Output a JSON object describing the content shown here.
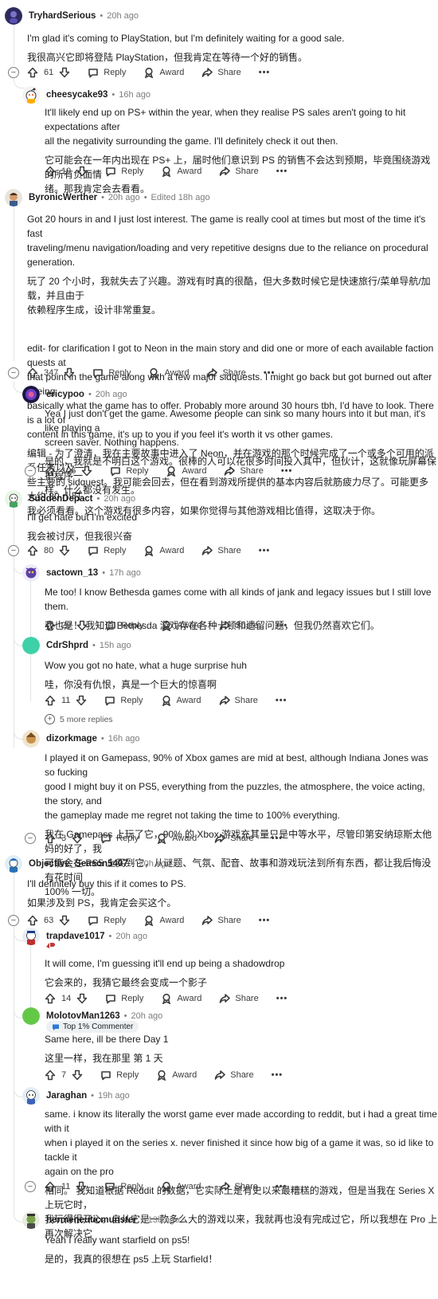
{
  "labels": {
    "reply": "Reply",
    "award": "Award",
    "share": "Share",
    "more": "•••"
  },
  "comments": [
    {
      "author": "TryhardSerious",
      "time": "20h ago",
      "votes": "61",
      "lines": [
        "I'm glad it's coming to PlayStation, but I'm definitely waiting for a good sale.",
        "我很高兴它即将登陆 PlayStation，但我肯定在等待一个好的销售。"
      ]
    },
    {
      "author": "cheesycake93",
      "time": "16h ago",
      "votes": "19",
      "lines": [
        "It'll likely end up on PS+ within the year, when they realise PS sales aren't going to hit expectations after",
        "all the negativity surrounding the game. I'll definitely check it out then.",
        "它可能会在一年内出现在 PS+ 上，届时他们意识到 PS 的销售不会达到预期，毕竟围绕游戏的所有负面情",
        "绪。那我肯定会去看看。"
      ]
    },
    {
      "author": "ByronicWerther",
      "time": "20h ago",
      "edited": "Edited 18h ago",
      "votes": "347",
      "lines": [
        "Got 20 hours in and I just lost interest. The game is really cool at times but most of the time it's fast",
        "traveling/menu navigation/loading and very repetitive designs due to the reliance on procedural generation.",
        "玩了 20 个小时，我就失去了兴趣。游戏有时真的很酷，但大多数时候它是快速旅行/菜单导航/加载，并且由于",
        "依赖程序生成，设计非常重复。",
        "edit- for clarification I got to Neon in the main story and did one or more of each available faction quests at",
        "that point in the game along with a few major sidquests. I might go back but got burned out after seeing",
        "basically what the game has to offer. Probably more around 30 hours tbh, I'd have to look. There is a lot of",
        "content in this game, it's up to you if you feel it's worth it vs other games.",
        "编辑 - 为了澄清，我在主要故事中进入了 Neon，并在游戏的那个时候完成了一个或多个可用的派系任务以及一",
        "些主要的 sidquest。我可能会回去，但在看到游戏所提供的基本内容后就筋疲力尽了。可能更多大约 30 小时，",
        "我必须看看。这个游戏有很多内容，如果你觉得与其他游戏相比值得，这取决于你。"
      ]
    },
    {
      "author": "ericypoo",
      "time": "20h ago",
      "votes": "106",
      "lines": [
        "Yea I just don't get the game. Awesome people can sink so many hours into it but man, it's like playing a",
        "screen saver. Nothing happens.",
        "是的，我就是不明白这个游戏。很棒的人可以花很多时间投入其中，但伙计，这就像玩屏幕保护程序一",
        "样。什么都没有发生。"
      ]
    },
    {
      "author": "SuddenDepact",
      "time": "20h ago",
      "votes": "80",
      "lines": [
        "I'll get hate but I'm excited",
        "我会被讨厌，但我很兴奋"
      ]
    },
    {
      "author": "sactown_13",
      "time": "17h ago",
      "votes": "20",
      "lines": [
        "Me too! I know Bethesda games come with all kinds of jank and legacy issues but I still love them.",
        "我也是！ 我知道 Bethesda 游戏存在各种卡顿和遗留问题，但我仍然喜欢它们。"
      ]
    },
    {
      "author": "CdrShprd",
      "time": "15h ago",
      "votes": "11",
      "lines": [
        "Wow you got no hate, what a huge surprise huh",
        "哇，你没有仇恨，真是一个巨大的惊喜啊"
      ],
      "more_replies": "5 more replies"
    },
    {
      "author": "dizorkmage",
      "time": "16h ago",
      "votes": "3",
      "lines": [
        "I played it on Gamepass, 90% of Xbox games are mid at best, although Indiana Jones was so fucking",
        "good I might buy it on PS5, everything from the puzzles, the atmosphere, the voice acting, the story, and",
        "the gameplay made me regret not taking the time to 100% everything.",
        "我在 Gamepass 上玩了它，90% 的 Xbox 游戏充其量只是中等水平，尽管印第安纳琼斯太他妈的好了，我",
        "可能会在 PS5 上买到它，从谜题、气氛、配音、故事和游戏玩法到所有东西，都让我后悔没有花时间",
        "100% 一切。"
      ]
    },
    {
      "author": "Objective_Season5407",
      "time": "20h ago",
      "votes": "63",
      "lines": [
        "I'll definitely buy this if it comes to PS.",
        "如果涉及到 PS，我肯定会买这个。"
      ]
    },
    {
      "author": "trapdave1017",
      "time": "20h ago",
      "votes": "14",
      "lines": [
        "It will come, I'm guessing it'll end up being a shadowdrop",
        "它会来的，我猜它最终会变成一个影子"
      ]
    },
    {
      "author": "MolotovMan1263",
      "time": "20h ago",
      "flair": "Top 1% Commenter",
      "votes": "7",
      "lines": [
        "Same here, ill be there Day 1",
        "这里一样，我在那里 第 1 天"
      ]
    },
    {
      "author": "Jaraghan",
      "time": "19h ago",
      "votes": "11",
      "lines": [
        "same. i know its literally the worst game ever made according to reddit, but i had a great time with it",
        "when i played it on the series x. never finished it since how big of a game it was, so id like to tackle it",
        "again on the pro",
        "相同。 我知道根据 Reddit 的数据，它实际上是有史以来最糟糕的游戏，但是当我在 Series X 上玩它时，",
        "我玩得很开心。自从它是一款多么大的游戏以来，我就再也没有完成过它，所以我想在 Pro 上再次解决它"
      ]
    },
    {
      "author": "hermeneuticmunster",
      "time": "13h ago",
      "lines": [
        "Yeah I really want starfield on ps5!",
        "是的，我真的很想在 ps5 上玩 Starfield！"
      ]
    }
  ]
}
